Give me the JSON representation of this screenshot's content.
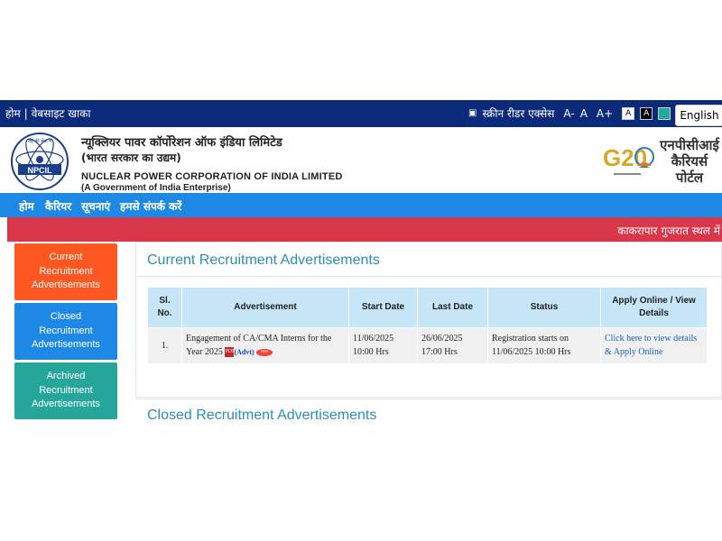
{
  "topbar": {
    "home": "होम",
    "sitemap": "वेबसाइट खाका",
    "screen_reader": "स्क्रीन रीडर एक्सेस",
    "font_minus": "A-",
    "font_normal": "A",
    "font_plus": "A+",
    "contrast_white": "A",
    "contrast_black": "A",
    "language_button": "English"
  },
  "colors": {
    "topbar": "#0c2a7a",
    "nav": "#1e88e5",
    "marquee": "#d9374a",
    "side_current": "#ff5722",
    "side_closed": "#1e88e5",
    "side_archived": "#26a69a",
    "heading": "#2a8fb5",
    "theme_teal": "#26a69a",
    "theme_red": "#e55a4e",
    "theme_darkteal": "#1a7f87"
  },
  "header": {
    "org_hindi": "न्यूक्लियर पावर कॉर्पोरेशन ऑफ इंडिया लिमिटेड",
    "org_hindi_sub": "(भारत सरकार का उद्यम)",
    "org_english": "NUCLEAR POWER CORPORATION OF INDIA LIMITED",
    "org_english_sub": "(A Government of India Enterprise)",
    "logo_text": "NPCIL",
    "logo_top_text": "राष्ट्र की सेवा में",
    "g20": "G20",
    "portal_title_lines": [
      "एनपीसीआई",
      "कैरियर्स",
      "पोर्टल"
    ]
  },
  "nav": {
    "items": [
      "होम",
      "कैरियर",
      "सूचनाएं",
      "हमसे संपर्क करें"
    ]
  },
  "marquee": {
    "text": "काकरापार गुजरात स्थल में"
  },
  "sidebar": {
    "items": [
      {
        "label": "Current Recruitment Advertisements"
      },
      {
        "label": "Closed Recruitment Advertisements"
      },
      {
        "label": "Archived Recruitment Advertisements"
      }
    ]
  },
  "main": {
    "current_heading": "Current Recruitment Advertisements",
    "closed_heading": "Closed Recruitment Advertisements",
    "table": {
      "headers": [
        "Sl. No.",
        "Advertisement",
        "Start Date",
        "Last Date",
        "Status",
        "Apply Online / View Details"
      ],
      "rows": [
        {
          "sl": "1.",
          "advertisement": "Engagement of CA/CMA Interns for the Year 2025",
          "advt_label": "(Advt)",
          "pdf_label": "PDF",
          "new_label": "new",
          "start": "11/06/2025 10:00 Hrs",
          "last": "26/06/2025 17:00 Hrs",
          "status": "Registration starts on 11/06/2025 10:00 Hrs",
          "link": "Click here to view details & Apply Online"
        }
      ]
    }
  }
}
